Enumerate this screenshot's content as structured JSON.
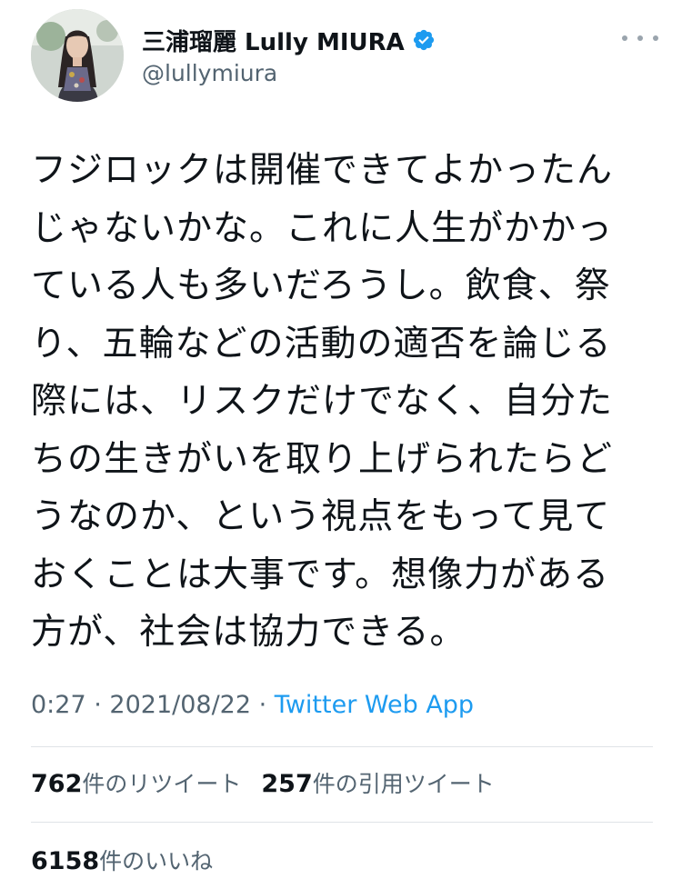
{
  "author": {
    "display_name": "三浦瑠麗 Lully MIURA",
    "handle": "@lullymiura",
    "verified": true,
    "avatar_icon": "profile-photo-avatar"
  },
  "tweet": {
    "lines": [
      "フジロックは開催できてよかったん",
      "じゃないかな。これに人生がかかっ",
      "ている人も多いだろうし。飲食、祭",
      "り、五輪などの活動の適否を論じる",
      "際には、リスクだけでなく、自分た",
      "ちの生きがいを取り上げられたらど",
      "うなのか、という視点をもって見て",
      "おくことは大事です。想像力がある",
      "方が、社会は協力できる。"
    ]
  },
  "meta": {
    "time": "0:27",
    "separator": "·",
    "date": "2021/08/22",
    "source": "Twitter Web App"
  },
  "stats": {
    "retweets_count": "762",
    "retweets_label": "件のリツイート",
    "quotes_count": "257",
    "quotes_label": "件の引用ツイート",
    "likes_count": "6158",
    "likes_label": "件のいいね"
  },
  "colors": {
    "text": "#0f1419",
    "secondary": "#536471",
    "link": "#1d9bf0",
    "verified": "#1d9bf0",
    "divider": "#dfe3e7"
  }
}
